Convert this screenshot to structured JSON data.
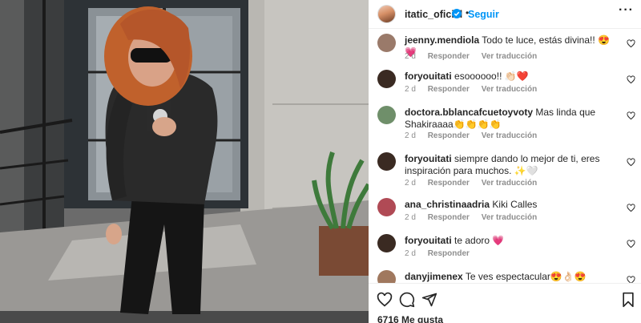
{
  "post": {
    "username": "itatic_oficial",
    "separator": "•",
    "follow_label": "Seguir",
    "more_label": "···",
    "likes_text": "6716 Me gusta"
  },
  "comments": [
    {
      "user": "jeenny.mendiola",
      "text": "Todo te luce, estás divina!! 😍💗",
      "time": "2 d",
      "reply": "Responder",
      "translate": "Ver traducción",
      "avatar_color": "#9a7a6a"
    },
    {
      "user": "foryouitati",
      "text": "esoooooo!! 👏🏻❤️",
      "time": "2 d",
      "reply": "Responder",
      "translate": "Ver traducción",
      "avatar_color": "#3a2a22"
    },
    {
      "user": "doctora.bblancafcuetoyvoty",
      "text": "Mas linda que Shakiraaaa👏👏👏👏",
      "time": "2 d",
      "reply": "Responder",
      "translate": "Ver traducción",
      "avatar_color": "#6f8f6a"
    },
    {
      "user": "foryouitati",
      "text": "siempre dando lo mejor de ti, eres inspiración para muchos. ✨🤍",
      "time": "2 d",
      "reply": "Responder",
      "translate": "Ver traducción",
      "avatar_color": "#3a2a22"
    },
    {
      "user": "ana_christinaadria",
      "text": "Kiki Calles",
      "time": "2 d",
      "reply": "Responder",
      "translate": "Ver traducción",
      "avatar_color": "#b04a55"
    },
    {
      "user": "foryouitati",
      "text": "te adoro 💗",
      "time": "2 d",
      "reply": "Responder",
      "translate": "",
      "avatar_color": "#3a2a22"
    },
    {
      "user": "danyjimenex",
      "text": "Te ves espectacular😍👌🏻😍",
      "time": "",
      "reply": "",
      "translate": "",
      "avatar_color": "#a0785e"
    }
  ],
  "icons": {
    "verified": "verified-badge-icon",
    "like": "heart-icon",
    "comment": "comment-icon",
    "share": "share-icon",
    "save": "bookmark-icon"
  },
  "colors": {
    "accent": "#0095f6",
    "muted": "#8e8e8e",
    "text": "#262626"
  }
}
